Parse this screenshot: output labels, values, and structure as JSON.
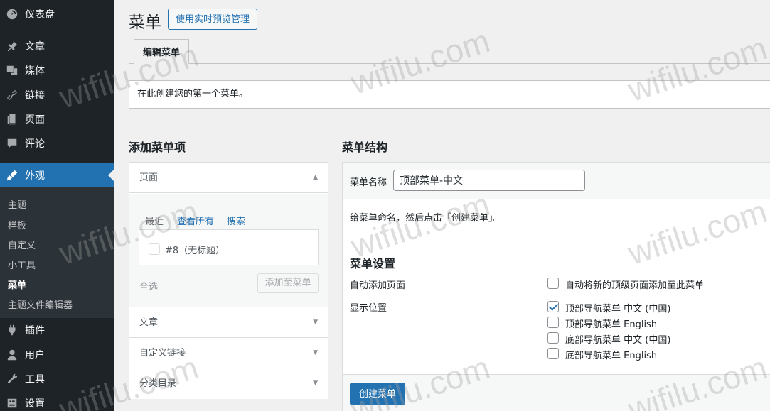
{
  "sidebar": {
    "items": [
      {
        "label": "仪表盘",
        "icon": "dashboard-icon"
      },
      {
        "label": "文章",
        "icon": "pin-icon"
      },
      {
        "label": "媒体",
        "icon": "media-icon"
      },
      {
        "label": "链接",
        "icon": "link-icon"
      },
      {
        "label": "页面",
        "icon": "page-icon"
      },
      {
        "label": "评论",
        "icon": "comment-icon"
      },
      {
        "label": "外观",
        "icon": "appearance-icon",
        "active": true
      },
      {
        "label": "插件",
        "icon": "plugin-icon"
      },
      {
        "label": "用户",
        "icon": "user-icon"
      },
      {
        "label": "工具",
        "icon": "tools-icon"
      },
      {
        "label": "设置",
        "icon": "settings-icon"
      }
    ],
    "submenu": [
      "主题",
      "样板",
      "自定义",
      "小工具",
      "菜单",
      "主题文件编辑器"
    ],
    "submenu_current": "菜单"
  },
  "header": {
    "title": "菜单",
    "live_preview_label": "使用实时预览管理"
  },
  "tabs": {
    "edit_menu": "编辑菜单"
  },
  "notice": "在此创建您的第一个菜单。",
  "add_items": {
    "heading": "添加菜单项",
    "sections": [
      "页面",
      "文章",
      "自定义链接",
      "分类目录"
    ],
    "page_tabs": [
      "最近",
      "查看所有",
      "搜索"
    ],
    "page_item": "#8（无标题）",
    "select_all": "全选",
    "add_to_menu": "添加至菜单"
  },
  "structure": {
    "heading": "菜单结构",
    "name_label": "菜单名称",
    "name_value": "顶部菜单-中文",
    "hint": "给菜单命名，然后点击「创建菜单」。",
    "settings_title": "菜单设置",
    "auto_add_label": "自动添加页面",
    "auto_add_option": "自动将新的顶级页面添加至此菜单",
    "auto_add_checked": false,
    "location_label": "显示位置",
    "locations": [
      {
        "label": "顶部导航菜单 中文 (中国)",
        "checked": true
      },
      {
        "label": "顶部导航菜单 English",
        "checked": false
      },
      {
        "label": "底部导航菜单 中文 (中国)",
        "checked": false
      },
      {
        "label": "底部导航菜单 English",
        "checked": false
      }
    ],
    "create_button": "创建菜单"
  },
  "watermark": "wifilu.com",
  "colors": {
    "accent": "#2271b1",
    "sidebar": "#1d2327",
    "submenu": "#2c3338"
  }
}
